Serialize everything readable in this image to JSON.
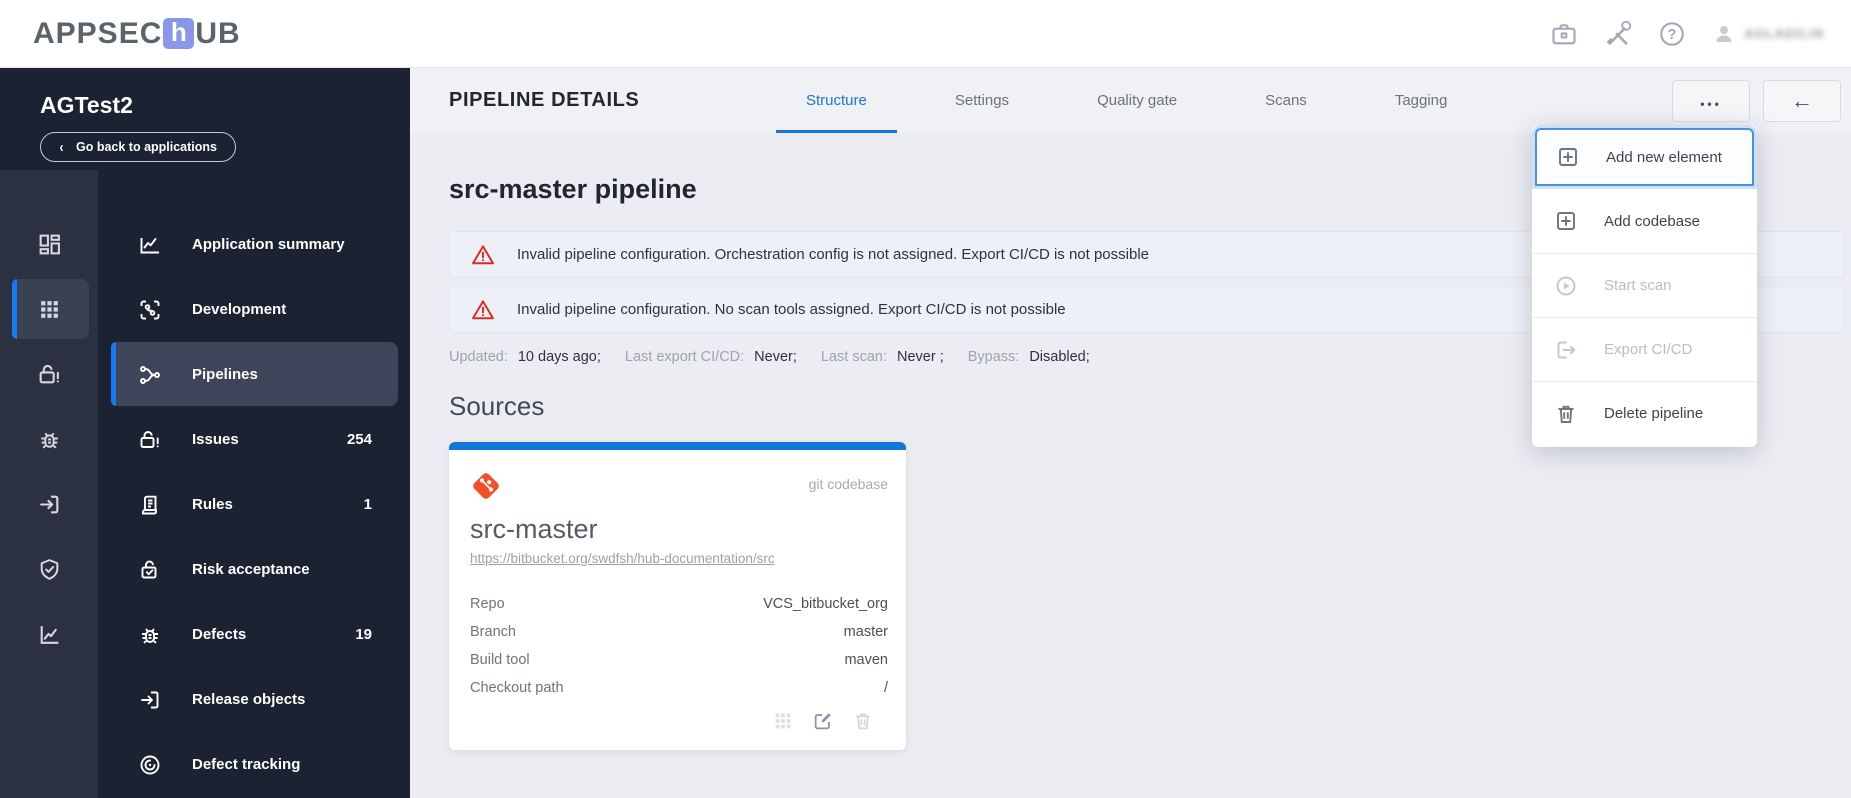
{
  "colors": {
    "accent_blue": "#1976d2",
    "sidebar_navy": "#1b2231",
    "rail_gray": "#2b3140",
    "active_item_bg": "#3e4459",
    "warning_red": "#e02b20",
    "card_bar_blue": "#1178d9",
    "git_orange": "#f34f29",
    "logo_box_blue": "#8a96e8"
  },
  "topbar": {
    "logo_pre": "APPSEC",
    "logo_mid": "h",
    "logo_post": "UB",
    "icons": [
      "briefcase-icon",
      "tools-icon",
      "help-icon",
      "user-icon"
    ],
    "user_label": "AGLADILIN"
  },
  "sidebar": {
    "app_name": "AGTest2",
    "back_button_label": "Go back to applications",
    "back_chevron": "‹",
    "rail": [
      {
        "name": "dashboard",
        "active": false
      },
      {
        "name": "applications",
        "active": true
      },
      {
        "name": "issues",
        "active": false
      },
      {
        "name": "defects",
        "active": false
      },
      {
        "name": "release",
        "active": false
      },
      {
        "name": "security",
        "active": false
      },
      {
        "name": "reports",
        "active": false
      }
    ],
    "menu": [
      {
        "label": "Application summary",
        "badge": ""
      },
      {
        "label": "Development",
        "badge": ""
      },
      {
        "label": "Pipelines",
        "badge": "",
        "active": true
      },
      {
        "label": "Issues",
        "badge": "254"
      },
      {
        "label": "Rules",
        "badge": "1"
      },
      {
        "label": "Risk acceptance",
        "badge": ""
      },
      {
        "label": "Defects",
        "badge": "19"
      },
      {
        "label": "Release objects",
        "badge": ""
      },
      {
        "label": "Defect tracking",
        "badge": ""
      }
    ]
  },
  "page": {
    "title": "PIPELINE DETAILS",
    "tabs": [
      {
        "label": "Structure",
        "active": true
      },
      {
        "label": "Settings",
        "active": false
      },
      {
        "label": "Quality gate",
        "active": false
      },
      {
        "label": "Scans",
        "active": false
      },
      {
        "label": "Tagging",
        "active": false
      }
    ],
    "more_button_label": "•••",
    "back_button_label": "←",
    "pipeline_title": "src-master pipeline",
    "warnings": [
      "Invalid pipeline configuration. Orchestration config is not assigned. Export CI/CD is not possible",
      "Invalid pipeline configuration. No scan tools assigned. Export CI/CD is not possible"
    ],
    "meta": [
      {
        "label": "Updated:",
        "value": "10 days ago;"
      },
      {
        "label": "Last export CI/CD:",
        "value": "Never;"
      },
      {
        "label": "Last scan:",
        "value": "Never ;"
      },
      {
        "label": "Bypass:",
        "value": "Disabled;"
      }
    ],
    "sources_heading": "Sources"
  },
  "card": {
    "type_label": "git codebase",
    "name": "src-master",
    "url": "https://bitbucket.org/swdfsh/hub-documentation/src",
    "fields": [
      {
        "label": "Repo",
        "value": "VCS_bitbucket_org"
      },
      {
        "label": "Branch",
        "value": "master"
      },
      {
        "label": "Build tool",
        "value": "maven"
      },
      {
        "label": "Checkout path",
        "value": "/"
      }
    ]
  },
  "context_menu": {
    "items": [
      {
        "label": "Add new element",
        "state": "focused"
      },
      {
        "label": "Add codebase",
        "state": "enabled"
      },
      {
        "label": "Start scan",
        "state": "disabled"
      },
      {
        "label": "Export CI/CD",
        "state": "disabled"
      },
      {
        "label": "Delete pipeline",
        "state": "enabled"
      }
    ]
  }
}
